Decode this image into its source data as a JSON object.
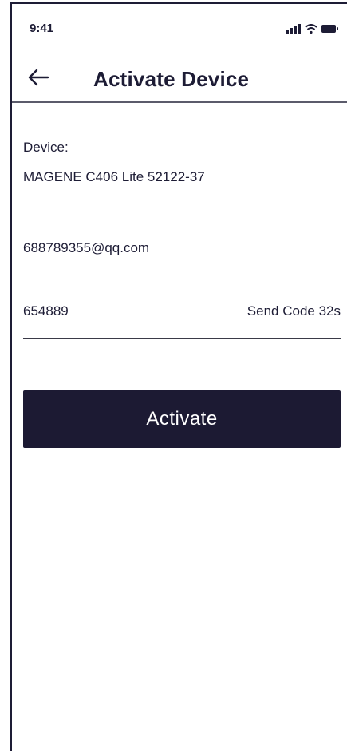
{
  "status_bar": {
    "time": "9:41",
    "icons": [
      "signal-icon",
      "wifi-icon",
      "battery-icon"
    ]
  },
  "header": {
    "back_icon": "arrow-left-icon",
    "title": "Activate Device"
  },
  "device": {
    "label": "Device:",
    "name": "MAGENE C406 Lite 52122-37"
  },
  "form": {
    "email_value": "688789355@qq.com",
    "code_value": "654889",
    "send_code_label": "Send Code 32s"
  },
  "actions": {
    "activate_label": "Activate"
  },
  "colors": {
    "primary": "#1c1a33",
    "text": "#1d1c35",
    "divider": "#3a3a48",
    "background": "#ffffff"
  }
}
